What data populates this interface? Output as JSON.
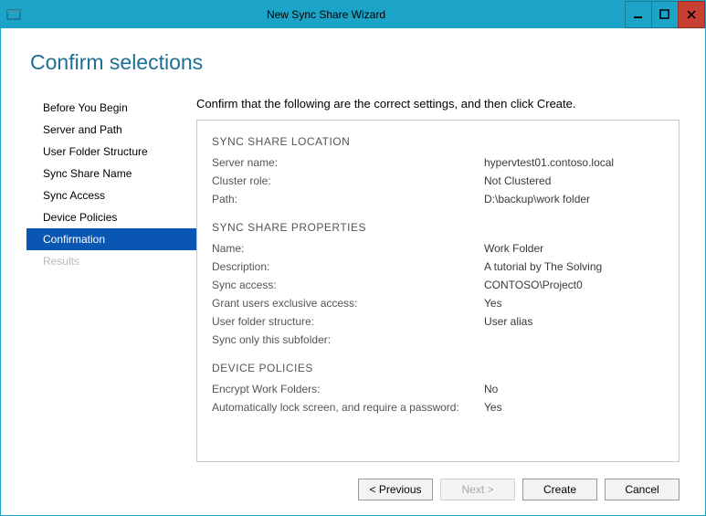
{
  "window": {
    "title": "New Sync Share Wizard"
  },
  "heading": "Confirm selections",
  "instruction": "Confirm that the following are the correct settings, and then click Create.",
  "steps": [
    {
      "label": "Before You Begin",
      "state": "normal",
      "name": "step-before-you-begin"
    },
    {
      "label": "Server and Path",
      "state": "normal",
      "name": "step-server-and-path"
    },
    {
      "label": "User Folder Structure",
      "state": "normal",
      "name": "step-user-folder-structure"
    },
    {
      "label": "Sync Share Name",
      "state": "normal",
      "name": "step-sync-share-name"
    },
    {
      "label": "Sync Access",
      "state": "normal",
      "name": "step-sync-access"
    },
    {
      "label": "Device Policies",
      "state": "normal",
      "name": "step-device-policies"
    },
    {
      "label": "Confirmation",
      "state": "selected",
      "name": "step-confirmation"
    },
    {
      "label": "Results",
      "state": "disabled",
      "name": "step-results"
    }
  ],
  "sections": {
    "location": {
      "title": "SYNC SHARE LOCATION",
      "server_name_k": "Server name:",
      "server_name_v": "hypervtest01.contoso.local",
      "cluster_role_k": "Cluster role:",
      "cluster_role_v": "Not Clustered",
      "path_k": "Path:",
      "path_v": "D:\\backup\\work folder"
    },
    "properties": {
      "title": "SYNC SHARE PROPERTIES",
      "name_k": "Name:",
      "name_v": "Work Folder",
      "description_k": "Description:",
      "description_v": "A tutorial by The Solving",
      "sync_access_k": "Sync access:",
      "sync_access_v": "CONTOSO\\Project0",
      "exclusive_k": "Grant users exclusive access:",
      "exclusive_v": "Yes",
      "folder_struct_k": "User folder structure:",
      "folder_struct_v": "User alias",
      "subfolder_k": "Sync only this subfolder:",
      "subfolder_v": ""
    },
    "device": {
      "title": "DEVICE POLICIES",
      "encrypt_k": "Encrypt Work Folders:",
      "encrypt_v": "No",
      "lock_k": "Automatically lock screen, and require a password:",
      "lock_v": "Yes"
    }
  },
  "buttons": {
    "previous": "< Previous",
    "next": "Next >",
    "create": "Create",
    "cancel": "Cancel"
  }
}
